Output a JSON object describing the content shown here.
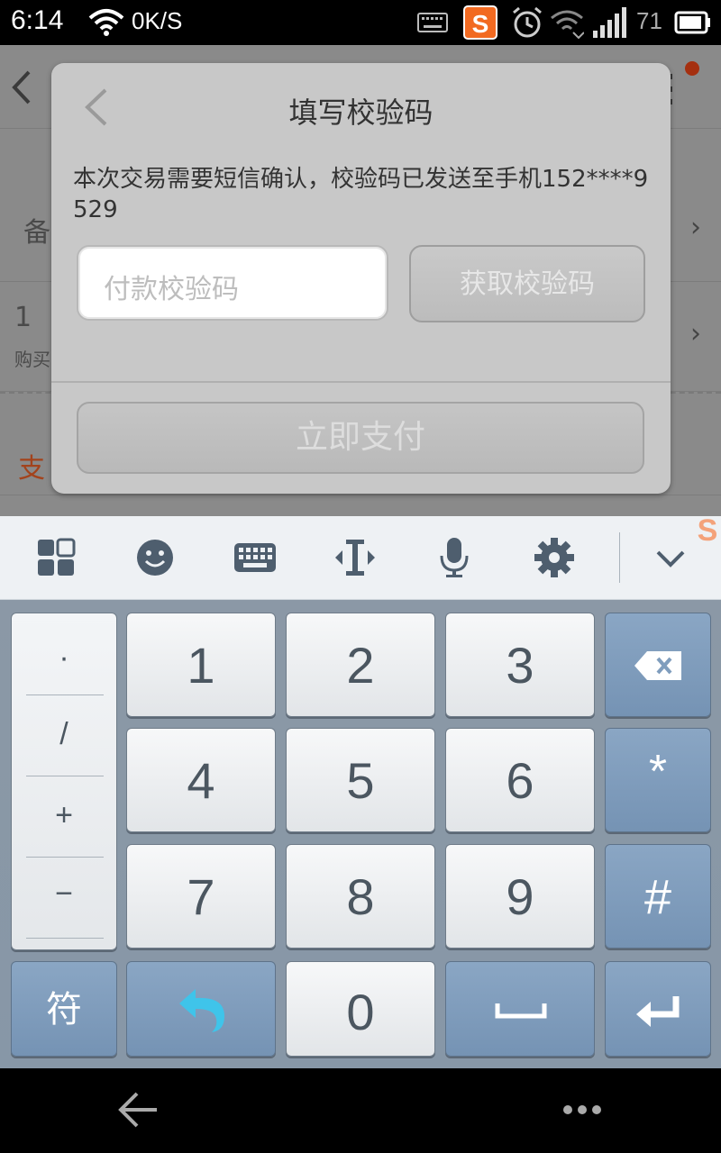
{
  "status_bar": {
    "time": "6:14",
    "net_speed": "0K/S",
    "battery_level": "71",
    "icons": [
      "wifi-icon",
      "keyboard-notification-icon",
      "sogou-icon",
      "alarm-icon",
      "wifi-alt-icon",
      "signal-icon",
      "battery-icon"
    ]
  },
  "background_app": {
    "row1_label": "备",
    "row2_value": "1",
    "row2_sub": "购买",
    "row3_label": "支"
  },
  "dialog": {
    "title": "填写校验码",
    "message": "本次交易需要短信确认，校验码已发送至手机152****9529",
    "input_placeholder": "付款校验码",
    "get_code_label": "获取校验码",
    "pay_label": "立即支付"
  },
  "keyboard": {
    "toolbar_icons": [
      "grid-menu-icon",
      "emoji-icon",
      "keyboard-icon",
      "cursor-icon",
      "microphone-icon",
      "settings-icon",
      "collapse-icon"
    ],
    "symbols": [
      "·",
      "/",
      "+",
      "−"
    ],
    "digits": [
      "1",
      "2",
      "3",
      "4",
      "5",
      "6",
      "7",
      "8",
      "9",
      "0"
    ],
    "star": "*",
    "hash": "#",
    "symbol_key": "符"
  },
  "colors": {
    "dialog_bg": "#c8c8c8",
    "key_blue": "#7f9dbd",
    "undo_cyan": "#3fc4ea",
    "orange_accent": "#a3431c"
  }
}
